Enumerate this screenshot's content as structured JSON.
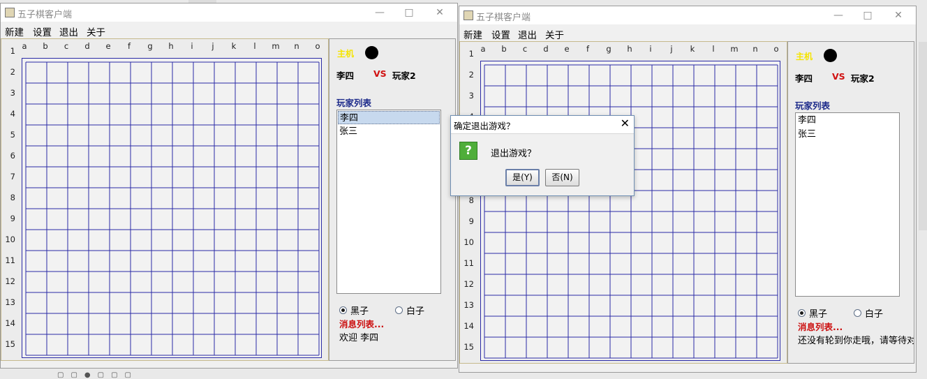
{
  "window": {
    "title": "五子棋客户端",
    "controls": {
      "minimize": "—",
      "maximize": "□",
      "close": "✕"
    }
  },
  "menu": [
    "新建",
    "设置",
    "退出",
    "关于"
  ],
  "board": {
    "columns": [
      "a",
      "b",
      "c",
      "d",
      "e",
      "f",
      "g",
      "h",
      "i",
      "j",
      "k",
      "l",
      "m",
      "n",
      "o"
    ],
    "rows": [
      "1",
      "2",
      "3",
      "4",
      "5",
      "6",
      "7",
      "8",
      "9",
      "10",
      "11",
      "12",
      "13",
      "14",
      "15"
    ],
    "grid_color": "#2a2aa5"
  },
  "left_panel": {
    "host_label": "主机",
    "player1": "李四",
    "vs": "VS",
    "player2": "玩家2",
    "list_title": "玩家列表",
    "players": [
      "李四",
      "张三"
    ],
    "selected_index": 0,
    "radio_black": "黑子",
    "radio_white": "白子",
    "selected_color": "black",
    "messages_title": "消息列表...",
    "message": "欢迎 李四"
  },
  "right_panel": {
    "host_label": "主机",
    "player1": "李四",
    "vs": "VS",
    "player2": "玩家2",
    "list_title": "玩家列表",
    "players": [
      "李四",
      "张三"
    ],
    "radio_black": "黑子",
    "radio_white": "白子",
    "selected_color": "black",
    "messages_title": "消息列表...",
    "message": "还没有轮到你走哦，请等待对"
  },
  "dialog": {
    "title": "确定退出游戏？",
    "close": "✕",
    "icon": "question-icon",
    "icon_glyph": "?",
    "message": "退出游戏？",
    "yes": "是(Y)",
    "no": "否(N)"
  },
  "colors": {
    "host": "#f5e400",
    "vs": "#d01010",
    "list_title": "#1c2a8a",
    "messages_title": "#cc1111"
  }
}
